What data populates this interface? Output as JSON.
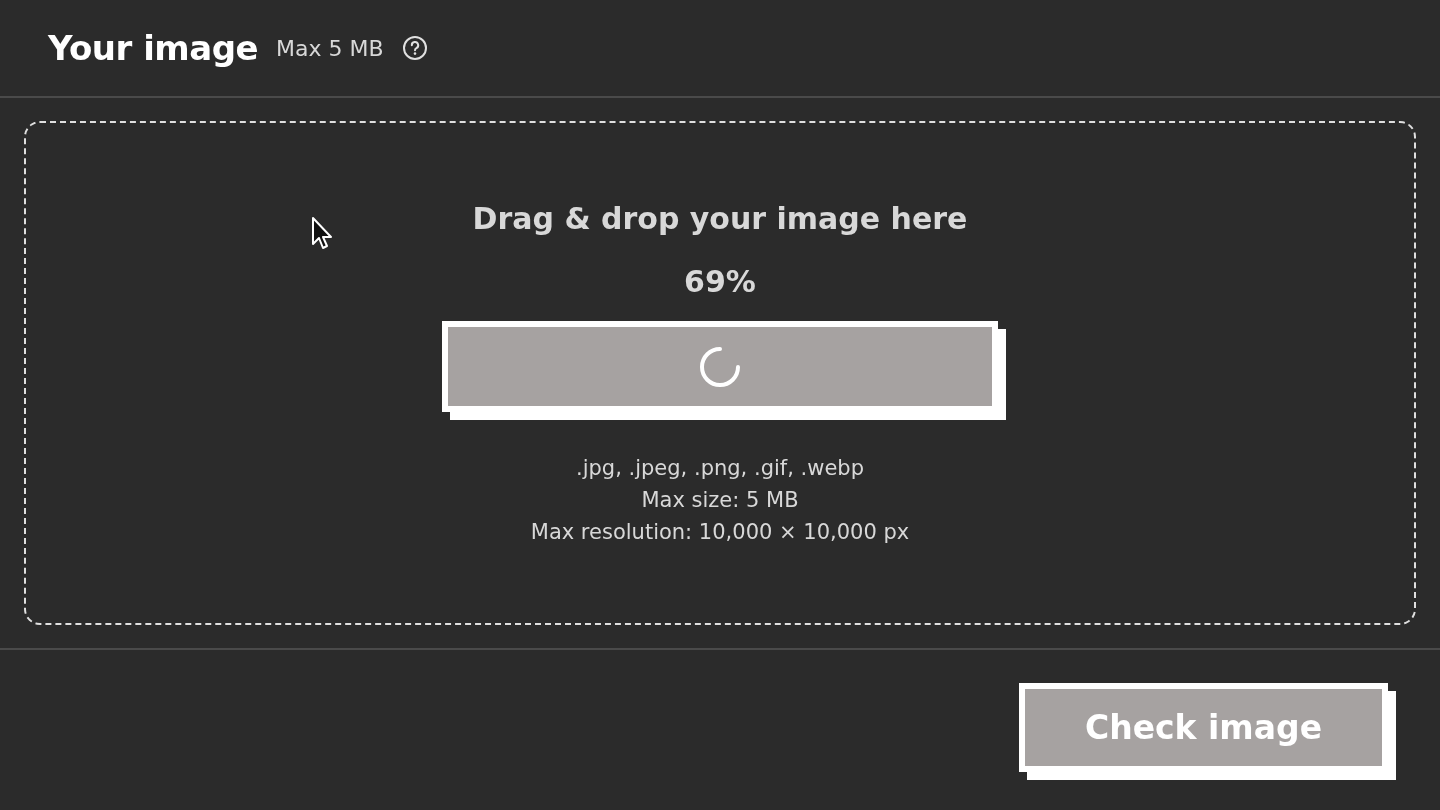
{
  "header": {
    "title": "Your image",
    "size_limit": "Max 5 MB"
  },
  "drop_zone": {
    "heading": "Drag & drop your image here",
    "progress": "69%",
    "upload_button": {
      "loading": true
    },
    "hints": [
      ".jpg, .jpeg, .png, .gif, .webp",
      "Max size: 5 MB",
      "Max resolution: 10,000 × 10,000 px"
    ]
  },
  "footer": {
    "button": "Check image"
  }
}
